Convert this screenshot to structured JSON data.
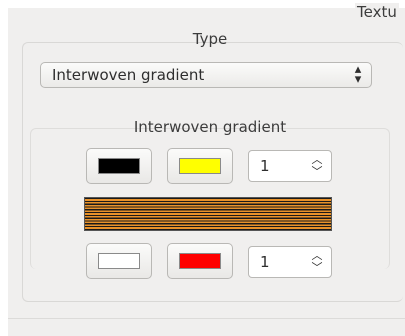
{
  "texture_label": "Textu",
  "type_group": {
    "title": "Type",
    "selected": "Interwoven gradient",
    "arrows_icon": "up-down-arrows-icon"
  },
  "gradient_group": {
    "title": "Interwoven gradient",
    "row1": {
      "color_a": "#000000",
      "color_b": "#ffff00",
      "count": "1"
    },
    "row2": {
      "color_a": "#ffffff",
      "color_b": "#ff0000",
      "count": "1"
    },
    "preview_colors": [
      "#1a1a1a",
      "#e8922a"
    ]
  }
}
